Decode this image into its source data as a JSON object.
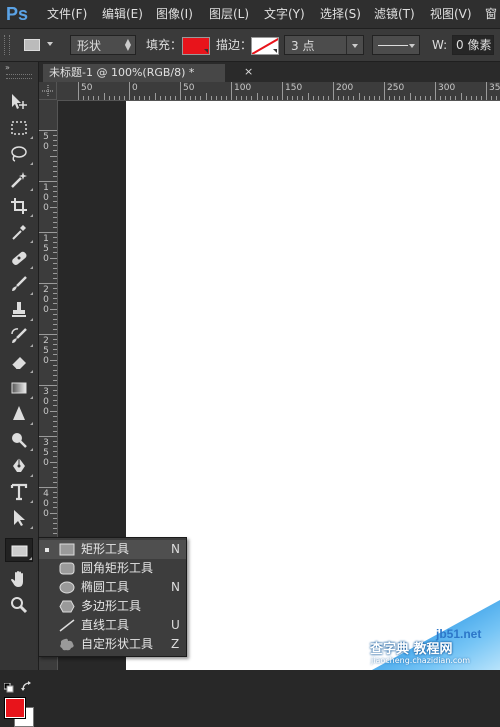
{
  "app": {
    "logo": "Ps"
  },
  "menubar": {
    "items": [
      "文件(F)",
      "编辑(E)",
      "图像(I)",
      "图层(L)",
      "文字(Y)",
      "选择(S)",
      "滤镜(T)",
      "视图(V)",
      "窗"
    ]
  },
  "options": {
    "shape_mode": "形状",
    "fill_label": "填充：",
    "fill_color": "#e8141b",
    "stroke_label": "描边：",
    "stroke_width": "3 点",
    "width_label": "W:",
    "width_value": "0 像素"
  },
  "document": {
    "tab_title": "未标题-1 @ 100%(RGB/8) *",
    "close_glyph": "×"
  },
  "rulers": {
    "top_labels": [
      "50",
      "0",
      "50",
      "100",
      "150",
      "200",
      "250",
      "300",
      "350"
    ],
    "left_labels": [
      "5 0",
      "1 0 0",
      "1 5 0",
      "2 0 0",
      "2 5 0",
      "3 0 0",
      "3 5 0",
      "4 0 0"
    ]
  },
  "toolbar": {
    "collapse_glyph": "»",
    "tools": [
      {
        "name": "move-tool-icon"
      },
      {
        "name": "marquee-tool-icon"
      },
      {
        "name": "lasso-tool-icon"
      },
      {
        "name": "magic-wand-tool-icon"
      },
      {
        "name": "crop-tool-icon"
      },
      {
        "name": "eyedropper-tool-icon"
      },
      {
        "name": "healing-brush-tool-icon"
      },
      {
        "name": "brush-tool-icon"
      },
      {
        "name": "clone-stamp-tool-icon"
      },
      {
        "name": "history-brush-tool-icon"
      },
      {
        "name": "eraser-tool-icon"
      },
      {
        "name": "gradient-tool-icon"
      },
      {
        "name": "blur-tool-icon"
      },
      {
        "name": "dodge-tool-icon"
      },
      {
        "name": "pen-tool-icon"
      },
      {
        "name": "type-tool-icon"
      },
      {
        "name": "path-selection-tool-icon"
      },
      {
        "name": "rectangle-tool-icon"
      },
      {
        "name": "hand-tool-icon"
      },
      {
        "name": "zoom-tool-icon"
      }
    ],
    "foreground_color": "#e8141b",
    "background_color": "#ffffff"
  },
  "flyout": {
    "items": [
      {
        "label": "矩形工具",
        "key": "N",
        "selected": true,
        "icon": "rectangle-icon"
      },
      {
        "label": "圆角矩形工具",
        "key": "",
        "selected": false,
        "icon": "rounded-rectangle-icon"
      },
      {
        "label": "椭圆工具",
        "key": "N",
        "selected": false,
        "icon": "ellipse-icon"
      },
      {
        "label": "多边形工具",
        "key": "",
        "selected": false,
        "icon": "polygon-icon"
      },
      {
        "label": "直线工具",
        "key": "U",
        "selected": false,
        "icon": "line-icon"
      },
      {
        "label": "自定形状工具",
        "key": "Z",
        "selected": false,
        "icon": "custom-shape-icon"
      }
    ]
  },
  "watermark": {
    "site": "jb51.net",
    "cn": "查字典 教程网",
    "url": "jiaocheng.chazidian.com"
  }
}
